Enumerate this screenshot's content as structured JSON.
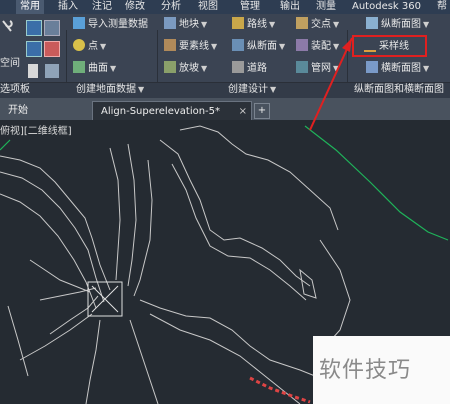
{
  "menu": {
    "tabs": [
      "常用",
      "插入",
      "注记",
      "修改",
      "分析",
      "视图",
      "管理",
      "输出",
      "测量",
      "Autodesk 360",
      "帮"
    ],
    "active": "常用"
  },
  "ribbon": {
    "left_panel": {
      "label_space": "空间",
      "title": "选项板"
    },
    "ground_data": {
      "import_survey": "导入测量数据",
      "point": "点",
      "surface": "曲面",
      "title": "创建地面数据"
    },
    "design": {
      "parcel": "地块",
      "feature_line": "要素线",
      "grading": "放坡",
      "alignment": "路线",
      "profile": "纵断面",
      "corridor": "道路",
      "intersection": "交点",
      "assembly": "装配",
      "pipe_network": "管网",
      "title": "创建设计"
    },
    "profile_section": {
      "profile_view": "纵断面图",
      "sample_line": "采样线",
      "section_view": "横断面图",
      "title": "纵断面图和横断面图"
    }
  },
  "doc_tabs": {
    "start": "开始",
    "drawing": "Align-Superelevation-5*",
    "new_tab": "+"
  },
  "viewport": {
    "label": "俯视][二维线框]"
  },
  "watermark": "软件技巧",
  "colors": {
    "highlight": "#e02020",
    "alignment_green": "#1fb35a"
  }
}
